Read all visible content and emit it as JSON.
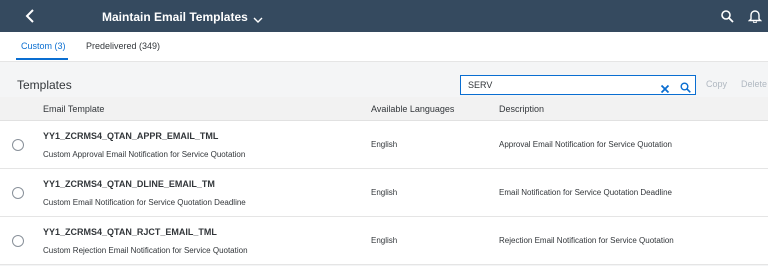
{
  "header": {
    "title": "Maintain Email Templates",
    "icons": [
      "back-icon",
      "chevron-down-icon",
      "search-icon",
      "bell-icon"
    ]
  },
  "tabs": [
    {
      "label": "Custom (3)",
      "selected": true
    },
    {
      "label": "Predelivered (349)",
      "selected": false
    }
  ],
  "toolbar": {
    "title": "Templates",
    "search_value": "SERV",
    "copy_label": "Copy",
    "delete_label": "Delete"
  },
  "table": {
    "columns": [
      "Email Template",
      "Available Languages",
      "Description"
    ],
    "rows": [
      {
        "id": "YY1_ZCRMS4_QTAN_APPR_EMAIL_TML",
        "name": "Custom Approval Email Notification for Service Quotation",
        "language": "English",
        "description": "Approval Email Notification for Service Quotation"
      },
      {
        "id": "YY1_ZCRMS4_QTAN_DLINE_EMAIL_TM",
        "name": "Custom Email Notification for Service Quotation Deadline",
        "language": "English",
        "description": "Email Notification for Service Quotation Deadline"
      },
      {
        "id": "YY1_ZCRMS4_QTAN_RJCT_EMAIL_TML",
        "name": "Custom Rejection Email Notification for Service Quotation",
        "language": "English",
        "description": "Rejection Email Notification for Service Quotation"
      }
    ]
  },
  "colors": {
    "shell": "#354a5f",
    "accent": "#0a6ed1",
    "background": "#f4f5f6",
    "disabled_text": "#b0b8c1"
  }
}
